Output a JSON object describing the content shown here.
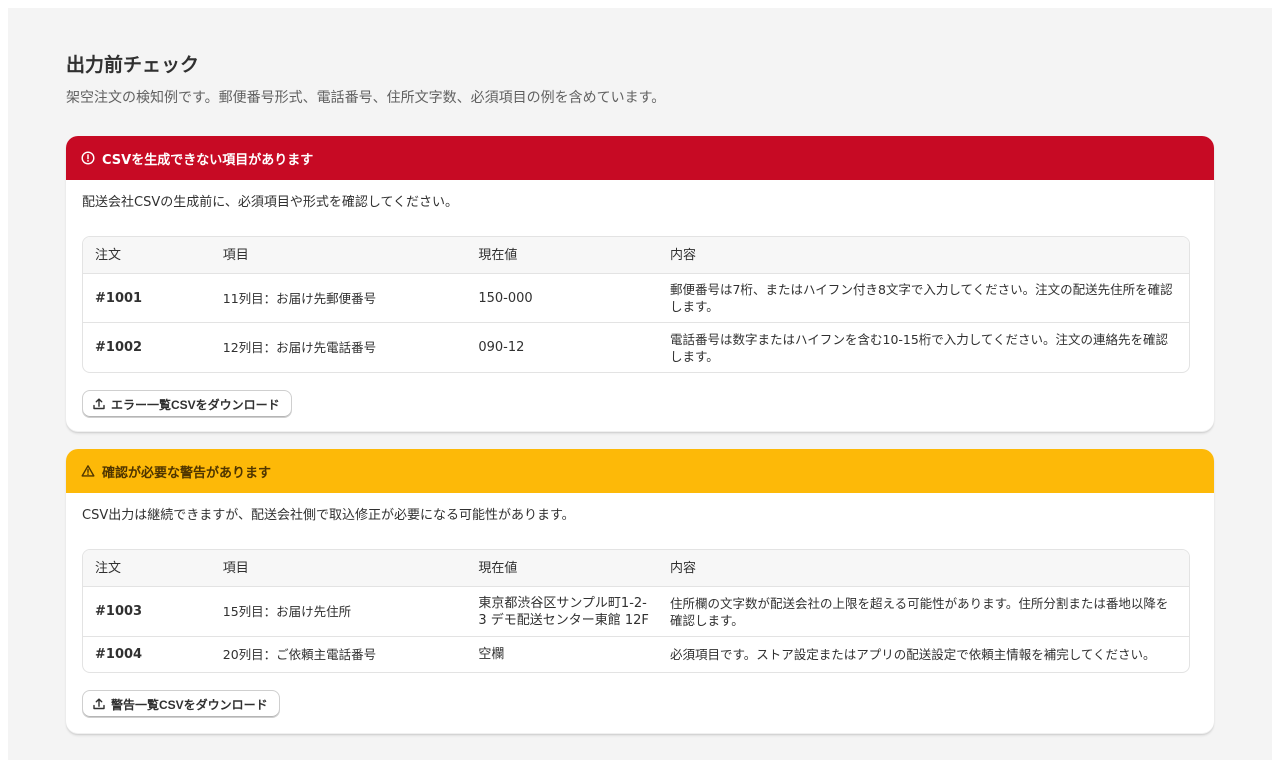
{
  "page": {
    "title": "出力前チェック",
    "subtitle": "架空注文の検知例です。郵便番号形式、電話番号、住所文字数、必須項目の例を含めています。"
  },
  "colors": {
    "critical": "#c70a24",
    "warning": "#fdb908"
  },
  "error_card": {
    "banner_icon": "alert-circle-icon",
    "banner_title": "CSVを生成できない項目があります",
    "description": "配送会社CSVの生成前に、必須項目や形式を確認してください。",
    "columns": [
      "注文",
      "項目",
      "現在値",
      "内容"
    ],
    "rows": [
      {
        "order": "#1001",
        "field": "11列目：お届け先郵便番号",
        "value": "150-000",
        "message": "郵便番号は7桁、またはハイフン付き8文字で入力してください。注文の配送先住所を確認します。"
      },
      {
        "order": "#1002",
        "field": "12列目：お届け先電話番号",
        "value": "090-12",
        "message": "電話番号は数字またはハイフンを含む10-15桁で入力してください。注文の連絡先を確認します。"
      }
    ],
    "download_icon": "export-icon",
    "download_label": "エラー一覧CSVをダウンロード"
  },
  "warning_card": {
    "banner_icon": "alert-triangle-icon",
    "banner_title": "確認が必要な警告があります",
    "description": "CSV出力は継続できますが、配送会社側で取込修正が必要になる可能性があります。",
    "columns": [
      "注文",
      "項目",
      "現在値",
      "内容"
    ],
    "rows": [
      {
        "order": "#1003",
        "field": "15列目：お届け先住所",
        "value": "東京都渋谷区サンプル町1-2-3 デモ配送センター東館 12F",
        "message": "住所欄の文字数が配送会社の上限を超える可能性があります。住所分割または番地以降を確認します。"
      },
      {
        "order": "#1004",
        "field": "20列目：ご依頼主電話番号",
        "value": "空欄",
        "message": "必須項目です。ストア設定またはアプリの配送設定で依頼主情報を補完してください。"
      }
    ],
    "download_icon": "export-icon",
    "download_label": "警告一覧CSVをダウンロード"
  }
}
